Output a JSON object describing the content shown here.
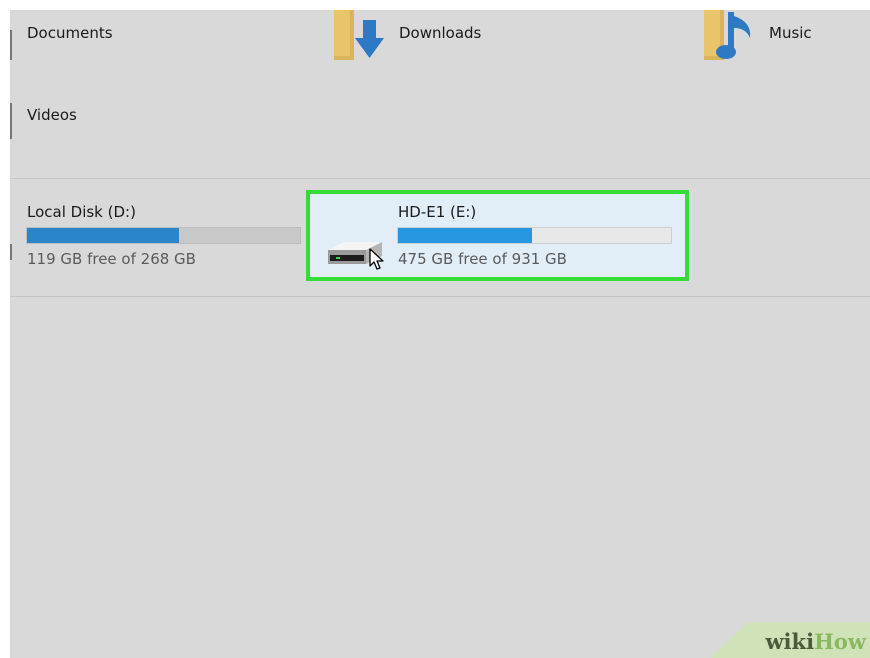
{
  "folders": [
    {
      "label": "Documents",
      "icon": "documents-folder-icon"
    },
    {
      "label": "Downloads",
      "icon": "downloads-folder-icon"
    },
    {
      "label": "Music",
      "icon": "music-folder-icon"
    },
    {
      "label": "Videos",
      "icon": "videos-folder-icon"
    }
  ],
  "drives": [
    {
      "name": "Local Disk (D:)",
      "free_text": "119 GB free of 268 GB",
      "used_fraction": 0.556,
      "selected": false
    },
    {
      "name": "HD-E1 (E:)",
      "free_text": "475 GB free of 931 GB",
      "used_fraction": 0.49,
      "selected": true,
      "icon": "hard-drive-icon"
    }
  ],
  "cursor": {
    "icon": "mouse-pointer-icon"
  },
  "watermark": {
    "part1": "wiki",
    "part2": "How"
  },
  "colors": {
    "background": "#d9d9d9",
    "selection_highlight": "#33dd33",
    "bar_fill": "#2a86c8",
    "selected_background": "#e2eef7"
  }
}
